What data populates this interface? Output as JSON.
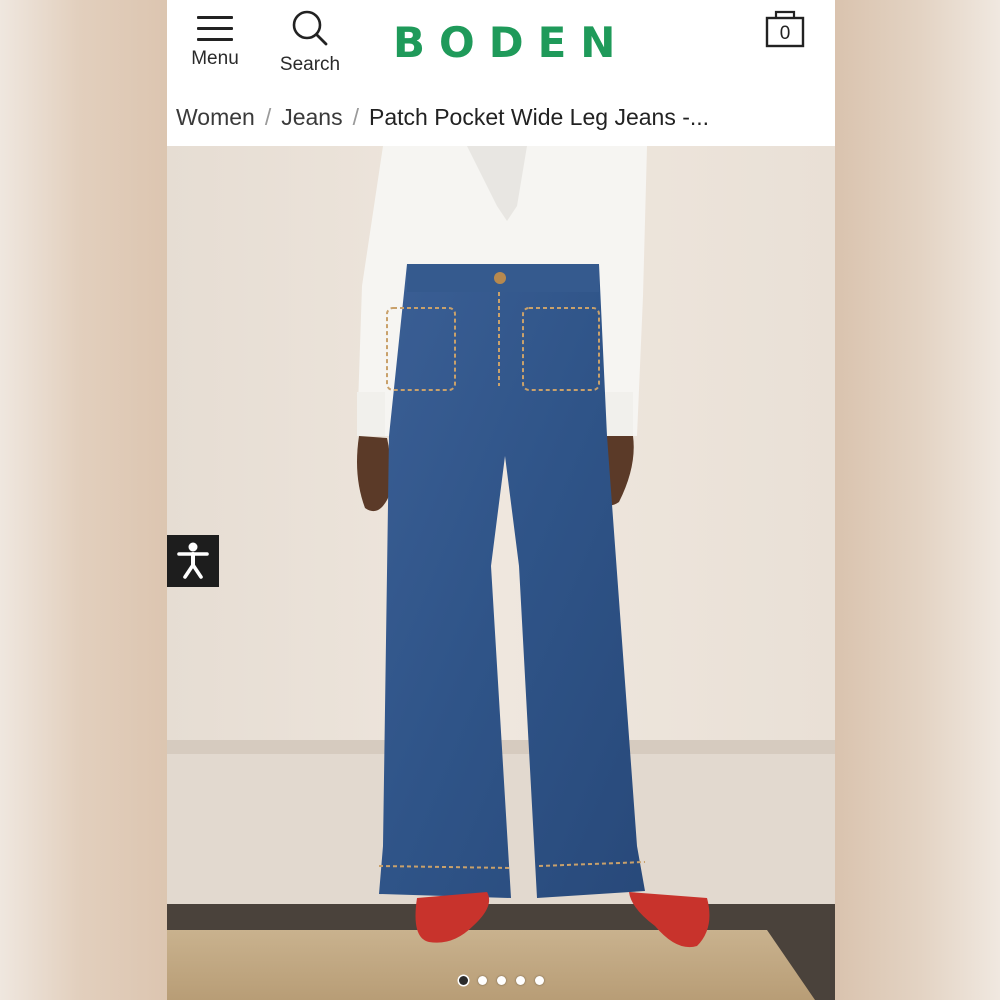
{
  "header": {
    "menu_label": "Menu",
    "search_label": "Search",
    "logo_text": "BODEN",
    "basket_count": "0",
    "brand_color": "#1f9a5a"
  },
  "breadcrumb": {
    "items": [
      "Women",
      "Jeans"
    ],
    "separator": "/",
    "current": "Patch Pocket Wide Leg Jeans -..."
  },
  "carousel": {
    "image_count": 5,
    "active_index": 0
  },
  "icons": {
    "menu": "hamburger-icon",
    "search": "search-icon",
    "basket": "basket-icon",
    "accessibility": "accessibility-icon"
  }
}
